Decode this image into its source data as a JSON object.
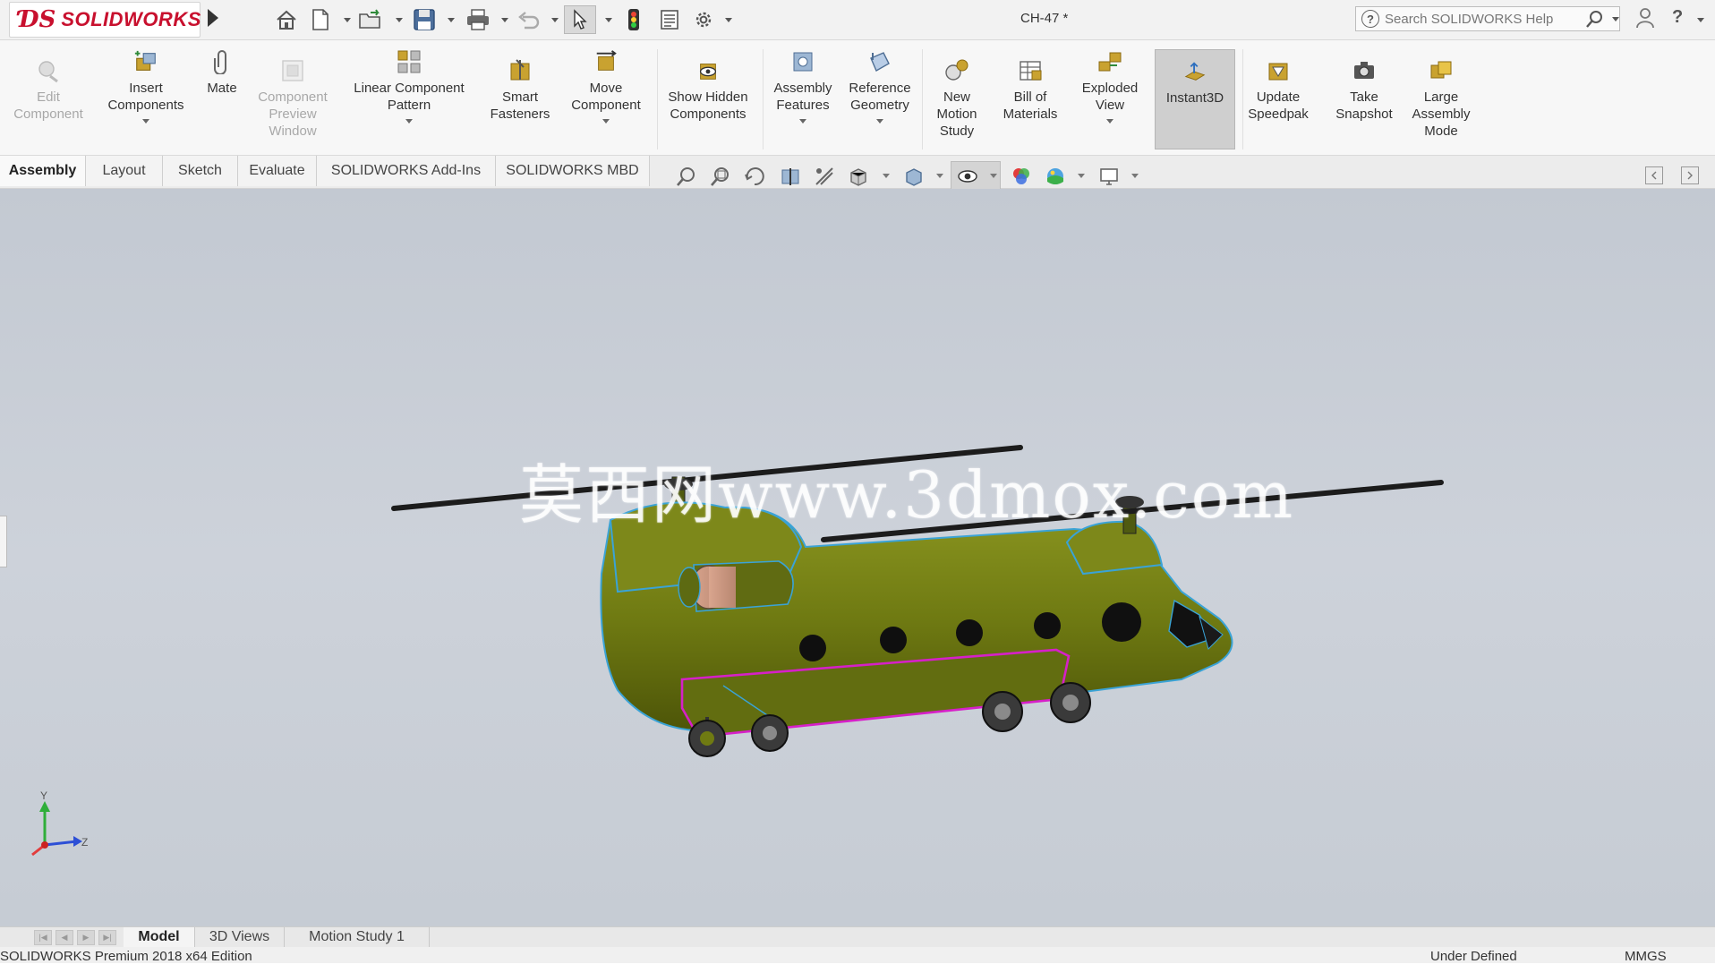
{
  "app": {
    "brand": "SOLIDWORKS",
    "document_title": "CH-47 *"
  },
  "search": {
    "placeholder": "Search SOLIDWORKS Help"
  },
  "quick_access": [
    "home-icon",
    "new-document-icon",
    "open-icon",
    "save-icon",
    "print-icon",
    "undo-icon",
    "select-icon",
    "rebuild-icon",
    "file-properties-icon",
    "options-icon"
  ],
  "ribbon": {
    "commands": [
      {
        "id": "edit-component",
        "label": "Edit Component",
        "enabled": false
      },
      {
        "id": "insert-components",
        "label": "Insert Components",
        "enabled": true,
        "dropdown": true
      },
      {
        "id": "mate",
        "label": "Mate",
        "enabled": true
      },
      {
        "id": "component-preview-window",
        "label": "Component Preview Window",
        "enabled": false
      },
      {
        "id": "linear-component-pattern",
        "label": "Linear Component Pattern",
        "enabled": true,
        "dropdown": true
      },
      {
        "id": "smart-fasteners",
        "label": "Smart Fasteners",
        "enabled": true
      },
      {
        "id": "move-component",
        "label": "Move Component",
        "enabled": true,
        "dropdown": true
      },
      {
        "id": "show-hidden-components",
        "label": "Show Hidden Components",
        "enabled": true
      },
      {
        "id": "assembly-features",
        "label": "Assembly Features",
        "enabled": true,
        "dropdown": true
      },
      {
        "id": "reference-geometry",
        "label": "Reference Geometry",
        "enabled": true,
        "dropdown": true
      },
      {
        "id": "new-motion-study",
        "label": "New Motion Study",
        "enabled": true
      },
      {
        "id": "bill-of-materials",
        "label": "Bill of Materials",
        "enabled": true
      },
      {
        "id": "exploded-view",
        "label": "Exploded View",
        "enabled": true,
        "dropdown": true
      },
      {
        "id": "instant3d",
        "label": "Instant3D",
        "enabled": true,
        "active": true
      },
      {
        "id": "update-speedpak",
        "label": "Update Speedpak",
        "enabled": true
      },
      {
        "id": "take-snapshot",
        "label": "Take Snapshot",
        "enabled": true
      },
      {
        "id": "large-assembly-mode",
        "label": "Large Assembly Mode",
        "enabled": true
      }
    ]
  },
  "tabs": [
    {
      "label": "Assembly",
      "active": true
    },
    {
      "label": "Layout"
    },
    {
      "label": "Sketch"
    },
    {
      "label": "Evaluate"
    },
    {
      "label": "SOLIDWORKS Add-Ins"
    },
    {
      "label": "SOLIDWORKS MBD"
    }
  ],
  "view_toolbar": [
    "zoom-to-fit-icon",
    "zoom-to-area-icon",
    "previous-view-icon",
    "section-view-icon",
    "dynamic-annotation-icon",
    "view-orientation-icon",
    "display-style-icon",
    "hide-show-items-icon",
    "edit-appearance-icon",
    "apply-scene-icon",
    "view-settings-icon"
  ],
  "viewport": {
    "watermark": "莫西网www.3dmox.com",
    "model": "CH-47 helicopter",
    "triad_labels": {
      "y": "Y",
      "z": "Z"
    }
  },
  "bottom_tabs": [
    {
      "label": "Model",
      "active": true
    },
    {
      "label": "3D Views"
    },
    {
      "label": "Motion Study 1"
    }
  ],
  "status_bar": {
    "product": "SOLIDWORKS Premium 2018 x64 Edition",
    "state": "Under Defined",
    "units": "MMGS"
  },
  "colors": {
    "brand_red": "#c8102e",
    "body_olive": "#6f7a12",
    "edge_blue": "#3aa3d6",
    "selection_magenta": "#d620c8"
  }
}
